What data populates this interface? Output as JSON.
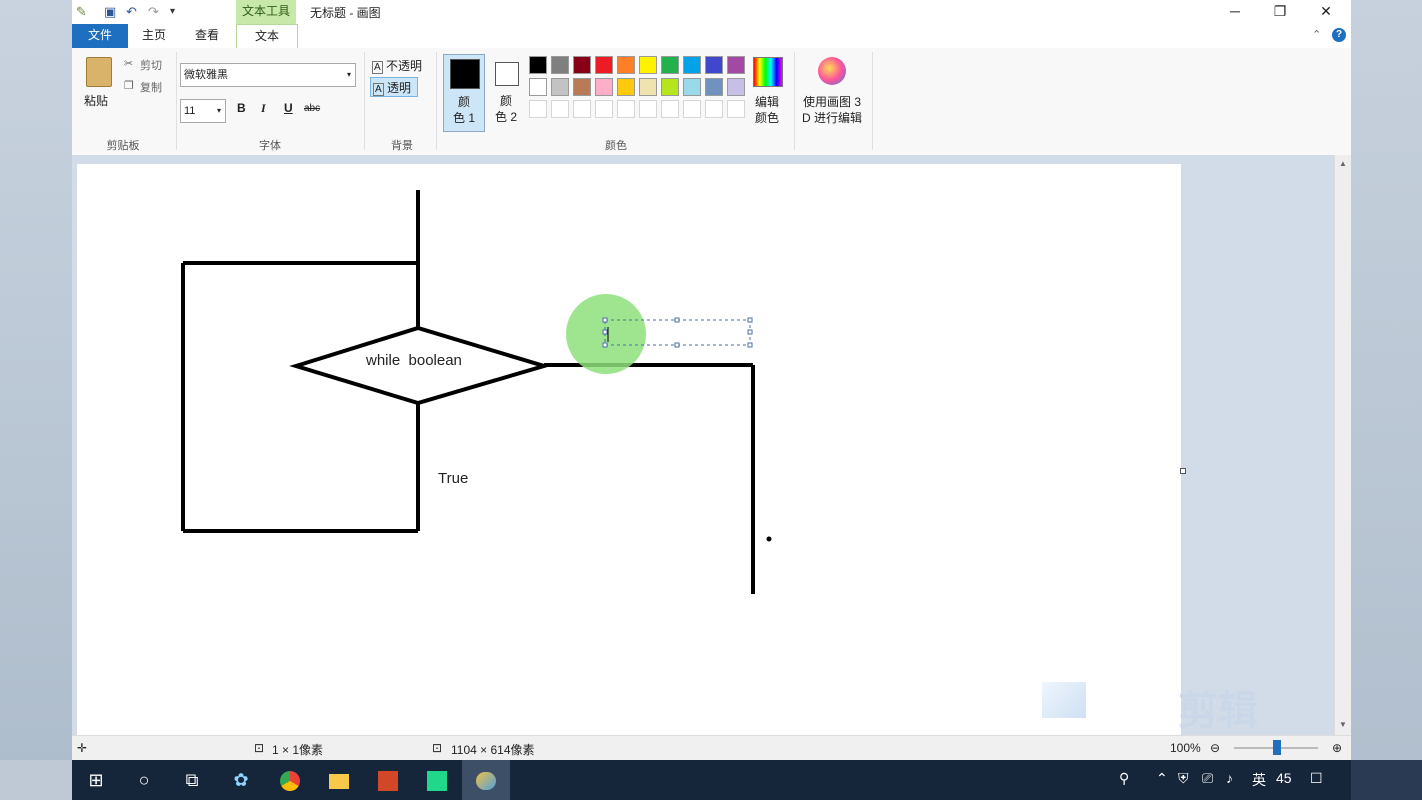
{
  "titlebar": {
    "context_tab": "文本工具",
    "title": "无标题 - 画图",
    "minimize_icon": "─",
    "maximize_icon": "❐",
    "close_icon": "✕"
  },
  "tabs": {
    "file": "文件",
    "home": "主页",
    "view": "查看",
    "text": "文本"
  },
  "ribbon": {
    "clipboard": {
      "paste": "粘贴",
      "cut": "剪切",
      "copy": "复制",
      "label": "剪贴板"
    },
    "font": {
      "family": "微软雅黑",
      "size": "11",
      "bold": "B",
      "italic": "I",
      "underline": "U",
      "strike": "abc",
      "label": "字体"
    },
    "background": {
      "opaque": "不透明",
      "transparent": "透明",
      "label": "背景"
    },
    "colors": {
      "color1_label": "颜\n色 1",
      "color1_a": "颜",
      "color1_b": "色 1",
      "color2_a": "颜",
      "color2_b": "色 2",
      "edit_a": "编辑",
      "edit_b": "颜色",
      "label": "颜色",
      "color1": "#000000",
      "color2": "#ffffff",
      "palette_row1": [
        "#000000",
        "#7f7f7f",
        "#880015",
        "#ed1c24",
        "#ff7f27",
        "#fff200",
        "#22b14c",
        "#00a2e8",
        "#3f48cc",
        "#a349a4"
      ],
      "palette_row2": [
        "#ffffff",
        "#c3c3c3",
        "#b97a57",
        "#ffaec9",
        "#ffc90e",
        "#efe4b0",
        "#b5e61d",
        "#99d9ea",
        "#7092be",
        "#c8bfe7"
      ]
    },
    "paint3d": {
      "line1": "使用画图 3",
      "line2": "D 进行编辑"
    }
  },
  "canvas": {
    "diamond_text": "while  boolean",
    "true_text": "True"
  },
  "watermark": "剪辑",
  "status": {
    "selection": "1 × 1像素",
    "size": "1104 × 614像素",
    "zoom": "100%"
  },
  "taskbar": {
    "ime": "英",
    "number": "45"
  }
}
